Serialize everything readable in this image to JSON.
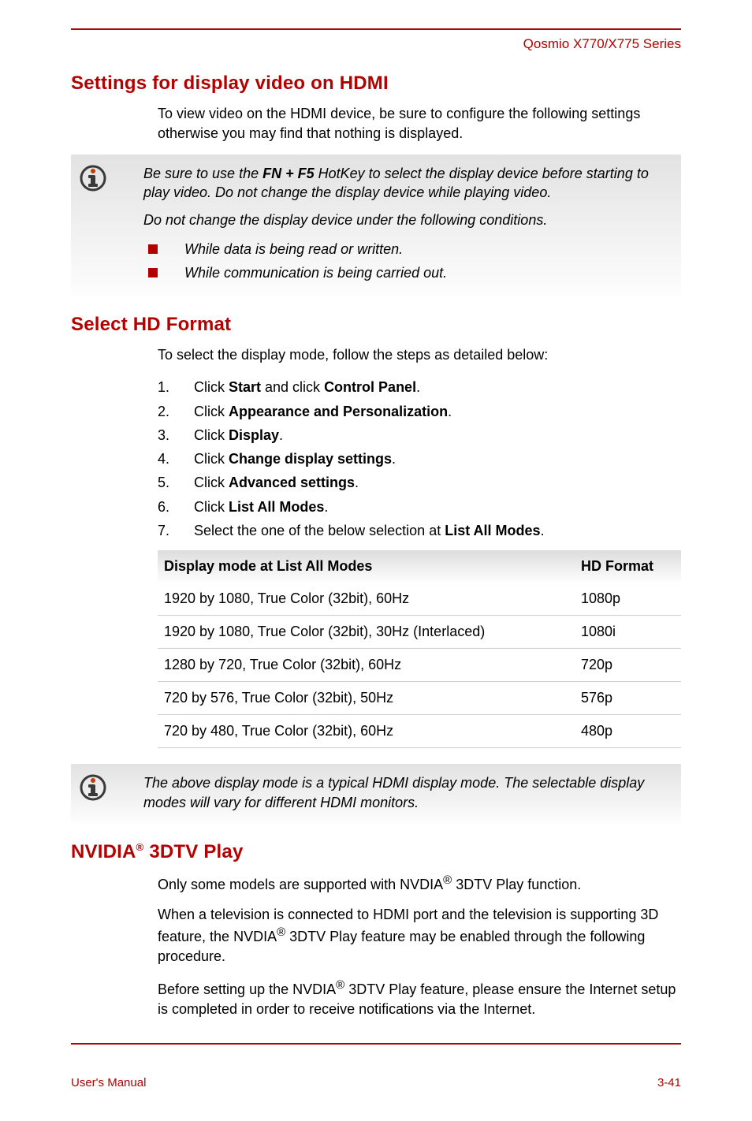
{
  "header": {
    "series": "Qosmio X770/X775 Series"
  },
  "section1": {
    "title": "Settings for display video on HDMI",
    "body": "To view video on the HDMI device, be sure to configure the following settings otherwise you may find that nothing is displayed."
  },
  "note1": {
    "p1_before": "Be sure to use the ",
    "p1_bold": "FN + F5",
    "p1_after": " HotKey to select the display device before starting to play video. Do not change the display device while playing video.",
    "p2": "Do not change the display device under the following conditions.",
    "items": [
      "While data is being read or written.",
      "While communication is being carried out."
    ]
  },
  "section2": {
    "title": "Select HD Format",
    "intro": "To select the display mode, follow the steps as detailed below:",
    "steps": [
      {
        "num": "1.",
        "pre": "Click ",
        "b1": "Start",
        "mid": " and click ",
        "b2": "Control Panel",
        "suf": "."
      },
      {
        "num": "2.",
        "pre": "Click ",
        "b1": "Appearance and Personalization",
        "mid": "",
        "b2": "",
        "suf": "."
      },
      {
        "num": "3.",
        "pre": "Click ",
        "b1": "Display",
        "mid": "",
        "b2": "",
        "suf": "."
      },
      {
        "num": "4.",
        "pre": "Click ",
        "b1": "Change display settings",
        "mid": "",
        "b2": "",
        "suf": "."
      },
      {
        "num": "5.",
        "pre": "Click ",
        "b1": "Advanced settings",
        "mid": "",
        "b2": "",
        "suf": "."
      },
      {
        "num": "6.",
        "pre": "Click ",
        "b1": "List All Modes",
        "mid": "",
        "b2": "",
        "suf": "."
      },
      {
        "num": "7.",
        "pre": "Select the one of the below selection at ",
        "b1": "List All Modes",
        "mid": "",
        "b2": "",
        "suf": "."
      }
    ]
  },
  "table": {
    "h1": "Display mode at List All Modes",
    "h2": "HD Format",
    "rows": [
      {
        "mode": "1920 by 1080, True Color (32bit), 60Hz",
        "fmt": "1080p"
      },
      {
        "mode": "1920 by 1080, True Color (32bit), 30Hz (Interlaced)",
        "fmt": "1080i"
      },
      {
        "mode": "1280 by 720, True Color (32bit), 60Hz",
        "fmt": "720p"
      },
      {
        "mode": "720 by 576, True Color (32bit), 50Hz",
        "fmt": "576p"
      },
      {
        "mode": "720 by 480, True Color (32bit), 60Hz",
        "fmt": "480p"
      }
    ]
  },
  "note2": {
    "text": "The above display mode is a typical HDMI display mode. The selectable display modes will vary for different HDMI monitors."
  },
  "section3": {
    "title_pre": "NVIDIA",
    "title_reg": "®",
    "title_post": " 3DTV Play",
    "p1_pre": "Only some models are supported with NVDIA",
    "p1_reg": "®",
    "p1_post": " 3DTV Play function.",
    "p2_pre": "When a television is connected to HDMI port and the television is supporting 3D feature, the NVDIA",
    "p2_reg": "®",
    "p2_post": " 3DTV Play feature may be enabled through the following procedure.",
    "p3_pre": "Before setting up the NVDIA",
    "p3_reg": "®",
    "p3_post": " 3DTV Play feature, please ensure the Internet setup is completed in order to receive notifications via the Internet."
  },
  "footer": {
    "left": "User's Manual",
    "right": "3-41"
  }
}
